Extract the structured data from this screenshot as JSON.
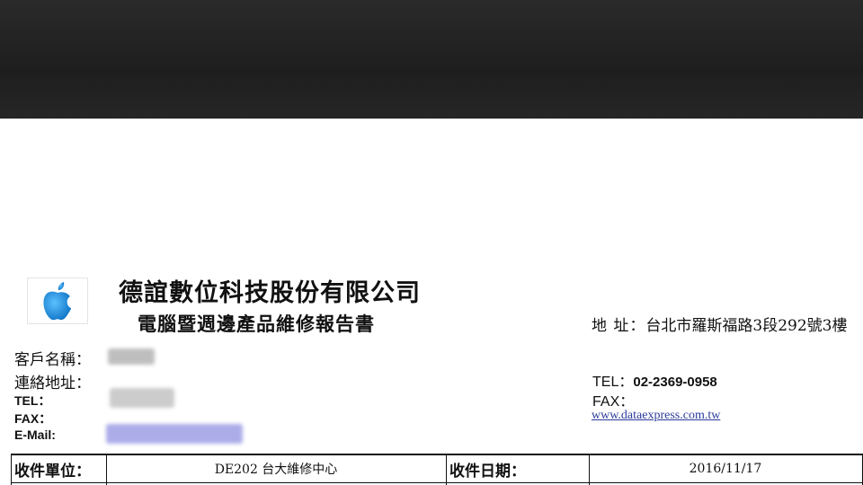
{
  "company": {
    "name": "德誼數位科技股份有限公司",
    "report_title": "電腦暨週邊產品維修報告書",
    "logo_icon": "apple-logo-icon",
    "address_label": "地 址：",
    "address": "台北市羅斯福路3段292號3樓",
    "tel_label": "TEL：",
    "tel": "02-2369-0958",
    "fax_label": "FAX：",
    "website": "www.dataexpress.com.tw"
  },
  "customer": {
    "name_label": "客戶名稱：",
    "address_label": "連絡地址：",
    "tel_label": "TEL：",
    "fax_label": "FAX：",
    "email_label": "E-Mail:"
  },
  "table": {
    "receiving_unit_label": "收件單位：",
    "receiving_unit_value": "DE202 台大維修中心",
    "receiving_date_label": "收件日期：",
    "receiving_date_value": "2016/11/17"
  },
  "colors": {
    "top_band": "#222222",
    "link": "#2b3b9c",
    "logo_blue": "#1a8fe0"
  }
}
